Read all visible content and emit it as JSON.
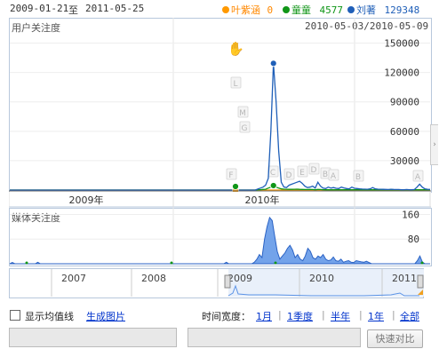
{
  "header": {
    "start_date": "2009-01-21",
    "to": "至",
    "end_date": "2011-05-25",
    "legend": [
      {
        "name": "叶紫涵",
        "value": "0",
        "color": "#ff9900"
      },
      {
        "name": "童童",
        "value": "4577",
        "color": "#109618"
      },
      {
        "name": "刘著",
        "value": "129348",
        "color": "#1f5fb8"
      }
    ]
  },
  "user_chart": {
    "title": "用户关注度",
    "date_range": "2010-05-03/2010-05-09",
    "year_labels": [
      "2009年",
      "2010年"
    ]
  },
  "media_chart": {
    "title": "媒体关注度"
  },
  "overview": {
    "years": [
      "2007",
      "2008",
      "2009",
      "2010",
      "2011"
    ]
  },
  "footer": {
    "show_average_label": "显示均值线",
    "generate_image": "生成图片",
    "time_width_label": "时间宽度：",
    "options": [
      "1月",
      "1季度",
      "半年",
      "1年",
      "全部"
    ],
    "compare_button": "快速对比"
  },
  "chart_data": [
    {
      "type": "line",
      "title": "用户关注度",
      "xlabel": "",
      "ylabel": "",
      "x_ticks": [
        "2009年",
        "2010年"
      ],
      "yticks": [
        30000,
        60000,
        90000,
        120000,
        150000
      ],
      "ylim": [
        0,
        165000
      ],
      "grid": true,
      "series": [
        {
          "name": "刘著",
          "color": "#1f5fb8",
          "values": [
            0,
            0,
            0,
            0,
            0,
            0,
            0,
            0,
            0,
            0,
            0,
            0,
            0,
            0,
            0,
            0,
            0,
            0,
            0,
            0,
            0,
            0,
            0,
            0,
            0,
            0,
            0,
            0,
            0,
            0,
            0,
            0,
            0,
            0,
            0,
            0,
            0,
            0,
            0,
            0,
            0,
            0,
            0,
            0,
            0,
            0,
            0,
            0,
            0,
            0,
            0,
            0,
            0,
            0,
            0,
            0,
            0,
            0,
            0,
            0,
            0,
            0,
            0,
            0,
            0,
            0,
            0,
            0,
            0,
            0,
            0,
            0,
            0,
            0,
            0,
            0,
            0,
            0,
            0,
            0,
            0,
            0,
            0,
            0,
            0,
            0,
            0,
            0,
            0,
            0,
            0,
            0,
            0,
            0,
            0,
            1000,
            2000,
            3000,
            5000,
            12000,
            60000,
            129348,
            90000,
            40000,
            8000,
            3000,
            2500,
            5000,
            6000,
            7000,
            8000,
            9000,
            7000,
            4000,
            2500,
            3000,
            4000,
            2000,
            8000,
            4000,
            2000,
            1500,
            3000,
            2000,
            2500,
            1800,
            1500,
            3000,
            2200,
            1500,
            1200,
            3000,
            1800,
            1500,
            1200,
            1000,
            900,
            800,
            1200,
            2500,
            1200,
            900,
            800,
            700,
            600,
            500,
            800,
            600,
            500,
            500,
            400,
            400,
            500,
            400,
            400,
            500,
            3000,
            6000,
            3000,
            1200,
            800,
            600
          ]
        },
        {
          "name": "童童",
          "color": "#109618",
          "values": [
            0,
            0,
            0,
            0,
            0,
            0,
            0,
            0,
            0,
            0,
            0,
            0,
            0,
            0,
            0,
            0,
            0,
            0,
            0,
            0,
            0,
            0,
            0,
            0,
            0,
            0,
            0,
            0,
            0,
            0,
            0,
            0,
            0,
            0,
            0,
            0,
            0,
            0,
            0,
            0,
            0,
            0,
            0,
            0,
            0,
            0,
            0,
            0,
            0,
            0,
            0,
            0,
            0,
            0,
            0,
            0,
            0,
            0,
            0,
            0,
            0,
            0,
            0,
            0,
            0,
            0,
            0,
            0,
            0,
            0,
            0,
            0,
            0,
            0,
            0,
            0,
            0,
            0,
            0,
            0,
            0,
            0,
            0,
            0,
            0,
            0,
            0,
            0,
            0,
            0,
            0,
            0,
            0,
            0,
            0,
            300,
            400,
            600,
            800,
            2000,
            3000,
            4577,
            3000,
            2000,
            1200,
            900,
            800,
            700,
            700,
            800,
            900,
            700,
            600,
            500,
            500,
            600,
            500,
            400,
            600,
            500,
            400,
            300,
            400,
            300,
            300,
            300,
            300,
            300,
            300,
            300,
            300,
            300,
            300,
            300,
            300,
            300,
            300,
            300,
            300,
            300,
            300,
            300,
            300,
            300,
            300,
            300,
            300,
            300,
            300,
            300,
            300,
            300,
            300,
            300,
            300,
            300,
            300,
            300,
            300,
            300,
            300,
            300
          ]
        },
        {
          "name": "叶紫涵",
          "color": "#ff9900",
          "values": [
            0,
            0,
            0,
            0,
            0,
            0,
            0,
            0,
            0,
            0,
            0,
            0,
            0,
            0,
            0,
            0,
            0,
            0,
            0,
            0,
            0,
            0,
            0,
            0,
            0,
            0,
            0,
            0,
            0,
            0,
            0,
            0,
            0,
            0,
            0,
            0,
            0,
            0,
            0,
            0,
            0,
            0,
            0,
            0,
            0,
            0,
            0,
            0,
            0,
            0,
            0,
            0,
            0,
            0,
            0,
            0,
            0,
            0,
            0,
            0,
            0,
            0,
            0,
            0,
            0,
            0,
            0,
            0,
            0,
            0,
            0,
            0,
            0,
            0,
            0,
            0,
            0,
            0,
            0,
            0,
            0,
            0,
            0,
            0,
            0,
            0,
            0,
            0,
            0,
            0,
            0,
            0,
            0,
            0,
            0,
            0,
            0,
            0,
            0,
            0,
            0,
            0,
            0,
            0,
            0,
            0,
            0,
            0,
            0,
            0,
            0,
            0,
            0,
            0,
            0,
            0,
            0,
            0,
            0,
            0,
            0,
            0,
            0,
            0,
            0,
            0,
            0,
            0,
            0,
            0,
            0,
            0,
            0,
            0,
            0,
            0,
            0,
            0,
            0,
            0,
            0,
            0,
            0,
            0,
            0,
            0,
            0,
            0,
            0,
            0,
            0,
            0,
            0,
            0,
            0,
            0,
            0,
            0,
            0,
            0,
            0,
            0,
            0,
            0,
            0,
            0
          ]
        }
      ],
      "annotations": [
        "L",
        "M",
        "G",
        "F",
        "C",
        "D",
        "E",
        "D",
        "B",
        "A",
        "B",
        "A"
      ]
    },
    {
      "type": "area",
      "title": "媒体关注度",
      "yticks": [
        80,
        160
      ],
      "ylim": [
        0,
        170
      ],
      "series": [
        {
          "name": "",
          "color": "#3a78d8",
          "values": [
            0,
            4,
            0,
            0,
            0,
            0,
            0,
            0,
            0,
            0,
            0,
            5,
            0,
            0,
            0,
            0,
            0,
            0,
            0,
            0,
            0,
            0,
            0,
            0,
            0,
            0,
            0,
            0,
            0,
            0,
            0,
            0,
            0,
            0,
            0,
            0,
            0,
            0,
            0,
            0,
            0,
            0,
            0,
            0,
            0,
            0,
            0,
            0,
            0,
            0,
            0,
            0,
            0,
            0,
            0,
            0,
            0,
            0,
            0,
            0,
            0,
            0,
            0,
            0,
            0,
            0,
            0,
            0,
            0,
            0,
            0,
            0,
            0,
            0,
            0,
            0,
            0,
            0,
            0,
            0,
            0,
            0,
            0,
            0,
            0,
            5,
            0,
            0,
            0,
            0,
            0,
            0,
            0,
            0,
            0,
            0,
            5,
            15,
            30,
            20,
            80,
            120,
            150,
            140,
            90,
            40,
            15,
            25,
            35,
            50,
            60,
            45,
            20,
            30,
            15,
            10,
            25,
            50,
            40,
            20,
            15,
            25,
            20,
            30,
            15,
            10,
            12,
            22,
            10,
            8,
            15,
            5,
            8,
            10,
            5,
            4,
            10,
            8,
            6,
            5,
            8,
            4,
            0,
            0,
            0,
            0,
            0,
            0,
            0,
            0,
            0,
            0,
            0,
            0,
            0,
            0,
            0,
            0,
            0,
            0,
            10,
            25,
            5,
            0,
            0,
            0
          ]
        }
      ]
    }
  ]
}
